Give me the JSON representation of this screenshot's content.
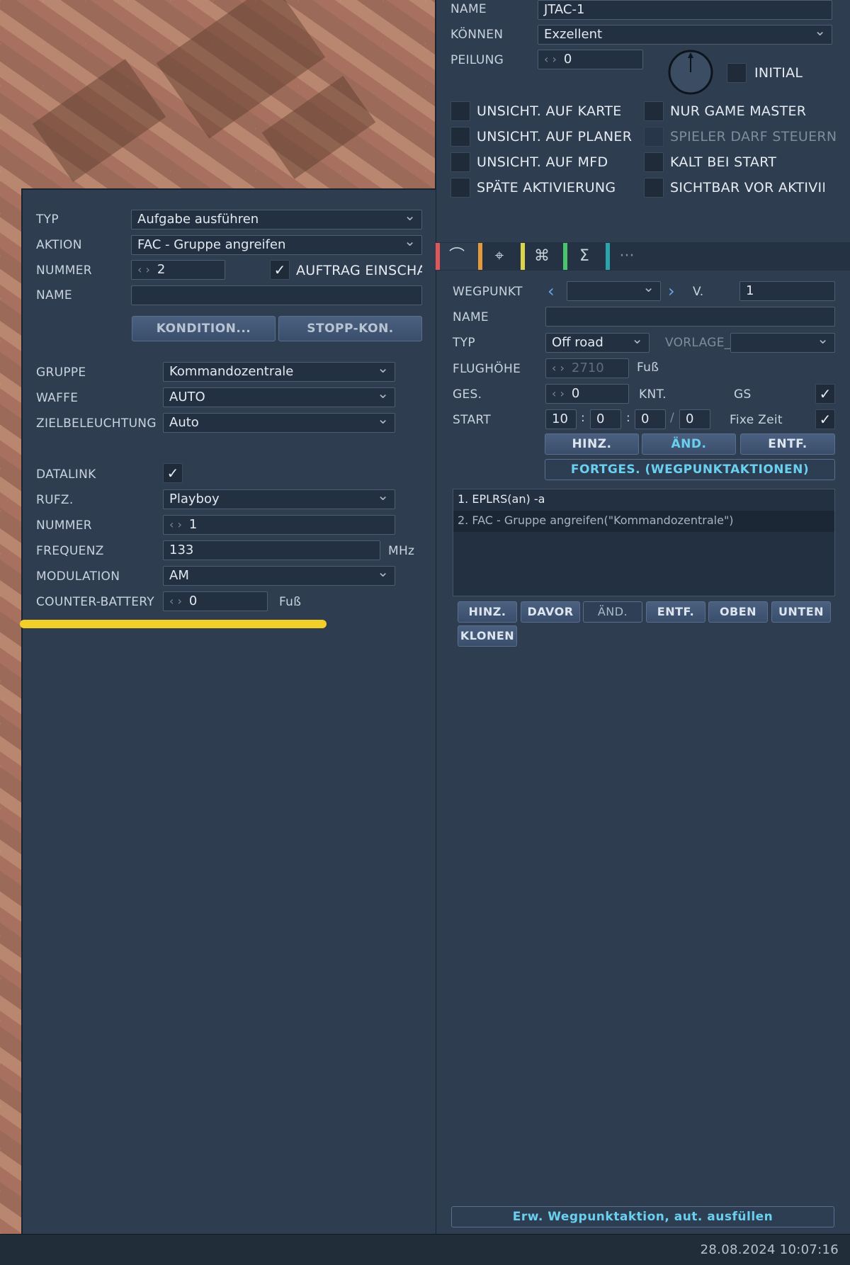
{
  "unit": {
    "name_label": "NAME",
    "name_value": "JTAC-1",
    "skill_label": "KÖNNEN",
    "skill_value": "Exzellent",
    "heading_label": "PEILUNG",
    "heading_value": "0",
    "initial_label": "INITIAL",
    "checks": [
      {
        "label": "UNSICHT. AUF KARTE",
        "checked": false
      },
      {
        "label": "NUR GAME MASTER",
        "checked": false
      },
      {
        "label": "UNSICHT. AUF PLANER",
        "checked": false
      },
      {
        "label": "SPIELER DARF STEUERN",
        "checked": false
      },
      {
        "label": "UNSICHT. AUF MFD",
        "checked": false
      },
      {
        "label": "KALT BEI START",
        "checked": false
      },
      {
        "label": "SPÄTE AKTIVIERUNG",
        "checked": false
      },
      {
        "label": "SICHTBAR VOR AKTIVIER",
        "checked": false
      }
    ]
  },
  "action": {
    "type_label": "TYP",
    "type_value": "Aufgabe ausführen",
    "action_label": "AKTION",
    "action_value": "FAC - Gruppe angreifen",
    "number_label": "NUMMER",
    "number_value": "2",
    "enable_label": "AUFTRAG EINSCHAL",
    "name_label": "NAME",
    "name_value": "",
    "condition_button": "KONDITION...",
    "stop_button": "STOPP-KON.",
    "group_label": "GRUPPE",
    "group_value": "Kommandozentrale",
    "weapon_label": "WAFFE",
    "weapon_value": "AUTO",
    "designation_label": "ZIELBELEUCHTUNG",
    "designation_value": "Auto",
    "datalink_label": "DATALINK",
    "callsign_label": "RUFZ.",
    "callsign_value": "Playboy",
    "callnum_label": "NUMMER",
    "callnum_value": "1",
    "freq_label": "FREQUENZ",
    "freq_value": "133",
    "freq_unit": "MHz",
    "mod_label": "MODULATION",
    "mod_value": "AM",
    "cb_label": "COUNTER-BATTERY",
    "cb_value": "0",
    "cb_unit": "Fuß"
  },
  "waypoint": {
    "wp_label": "WEGPUNKT",
    "wp_value": "",
    "v_label": "V.",
    "v_value": "1",
    "name_label": "NAME",
    "name_value": "",
    "type_label": "TYP",
    "type_value": "Off road",
    "template_label": "VORLAGE_",
    "template_value": "",
    "alt_label": "FLUGHÖHE",
    "alt_value": "2710",
    "alt_unit": "Fuß",
    "speed_label": "GES.",
    "speed_value": "0",
    "speed_unit": "KNT.",
    "gs_label": "GS",
    "start_label": "START",
    "start_h": "10",
    "start_m": "0",
    "start_s": "0",
    "start_d": "0",
    "sep1": ":",
    "sep2": ":",
    "sep3": "/",
    "fixed_label": "Fixe Zeit",
    "add_btn": "HINZ.",
    "edit_btn": "ÄND.",
    "del_btn": "ENTF.",
    "advanced_btn": "FORTGES. (WEGPUNKTAKTIONEN)",
    "actions": [
      "1. EPLRS(an)  -a",
      "2. FAC - Gruppe angreifen(\"Kommandozentrale\")"
    ],
    "list_buttons": [
      "HINZ.",
      "DAVOR",
      "ÄND.",
      "ENTF.",
      "OBEN",
      "UNTEN"
    ],
    "clone_btn": "KLONEN",
    "auto_btn": "Erw. Wegpunktaktion, aut. ausfüllen"
  },
  "status": {
    "datetime": "28.08.2024 10:07:16"
  },
  "colors": {
    "tab_red": "#e0575a",
    "tab_orange": "#e39a3b",
    "tab_yellow": "#d9d44a",
    "tab_green": "#49c46a",
    "tab_teal": "#2aa4a8",
    "highlight": "#f3cf2a",
    "accent": "#6ad0f0"
  }
}
